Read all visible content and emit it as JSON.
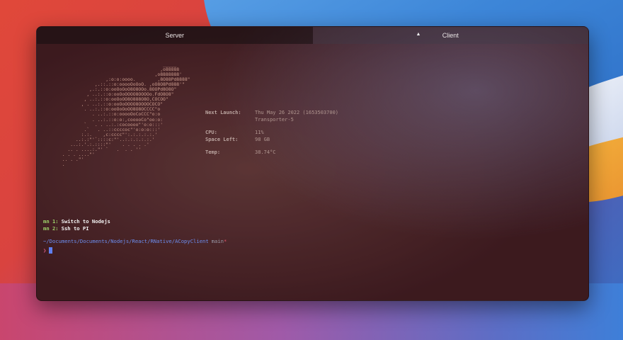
{
  "tabs": [
    {
      "label": "Server",
      "active": true
    },
    {
      "label": "Client",
      "active": false,
      "indicator": "▲"
    }
  ],
  "ascii_art": [
    "                                       _____",
    "                                      ,o88888",
    "                                    ,o8888888'",
    "                  ,:o:o:oooo.        ,8O88Pd8888\"",
    "              ,.::.::o:ooooOoOoO. ,oO8O8Pd888'\"",
    "            ,.:.::o:ooOoOoO8O8OOo.8OOPd8O8O\"",
    "           , ..:.::o:ooOoOOOO8OOOOo.FdO8O8\"",
    "          , ..:.::o:ooOoOO8O888O8O,COCOO\"",
    "         , . ..:.::o:ooOoOOOO8OOOOCOCO\"",
    "          . ..:.::o:ooOoOoOO8O8OCCCC\"o",
    "             . ..:.::o:ooooOoCoCCC\"o:o",
    "             . ..:.::o:o:,cooooCo\"oo:o:",
    "          `   . . ..:.:cocoooo\"'o:o:::'",
    "          .`   . ..::ccccoc\"'o:o:o:::'",
    "         :.:.    ,c:cccc\"':.:.:.:.:.'",
    "       ..:.:\"'`::::c:\"'..:.:.:.:.:.'",
    "     ...:.'.:.::::\"'    . . . . .'",
    "    .. . ....:.\"' `   .  . . ''",
    "  . . . ....\"'",
    "  .. . .\"'",
    "  ."
  ],
  "info": {
    "next_launch_label": "Next Launch:",
    "next_launch_value": "Thu May 26 2022 (1653503700)",
    "rocket_value": "Transporter-5",
    "cpu_label": "CPU:",
    "cpu_value": "11%",
    "space_label": "Space Left:",
    "space_value": "98 GB",
    "temp_label": "Temp:",
    "temp_value": "38.74°C"
  },
  "menu": [
    {
      "key": "mn 1:",
      "text": "Switch to Nodejs"
    },
    {
      "key": "mn 2:",
      "text": "Ssh to PI"
    }
  ],
  "prompt": {
    "path": "~/Documents/Documents/Nodejs/React/RNative/ACopyClient",
    "branch": "main",
    "dirty": "*",
    "symbol": "❯"
  }
}
